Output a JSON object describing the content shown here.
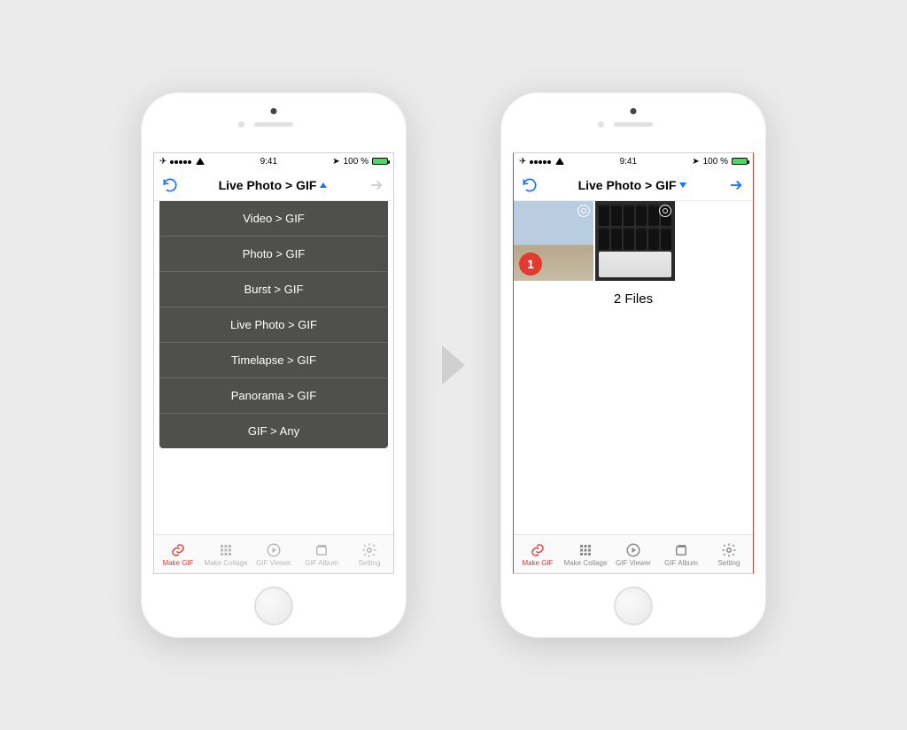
{
  "status": {
    "time": "9:41",
    "battery": "100 %"
  },
  "nav": {
    "title": "Live Photo > GIF"
  },
  "dropdown": [
    "Video > GIF",
    "Photo > GIF",
    "Burst > GIF",
    "Live Photo > GIF",
    "Timelapse > GIF",
    "Panorama > GIF",
    "GIF > Any"
  ],
  "phone2": {
    "selected_index": "1",
    "file_count_label": "2 Files"
  },
  "tabs": [
    {
      "label": "Make GIF"
    },
    {
      "label": "Make Collage"
    },
    {
      "label": "GIF Viewer"
    },
    {
      "label": "GIF Album"
    },
    {
      "label": "Setting"
    }
  ]
}
